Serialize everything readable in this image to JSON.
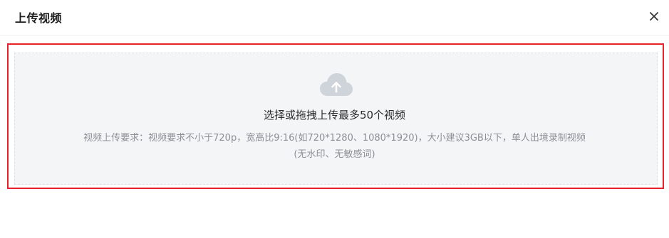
{
  "dialog": {
    "title": "上传视频",
    "close_icon": "close-icon"
  },
  "upload": {
    "icon": "cloud-upload-icon",
    "prompt": "选择或拖拽上传最多50个视频",
    "requirements_line1": "视频上传要求：视频要求不小于720p，宽高比9:16(如720*1280、1080*1920)，大小建议3GB以下，单人出境录制视频",
    "requirements_line2": "(无水印、无敏感词)"
  },
  "colors": {
    "highlight_border": "#e8222b",
    "drop_zone_bg": "#f4f5f7",
    "icon_color": "#cfd3da"
  }
}
